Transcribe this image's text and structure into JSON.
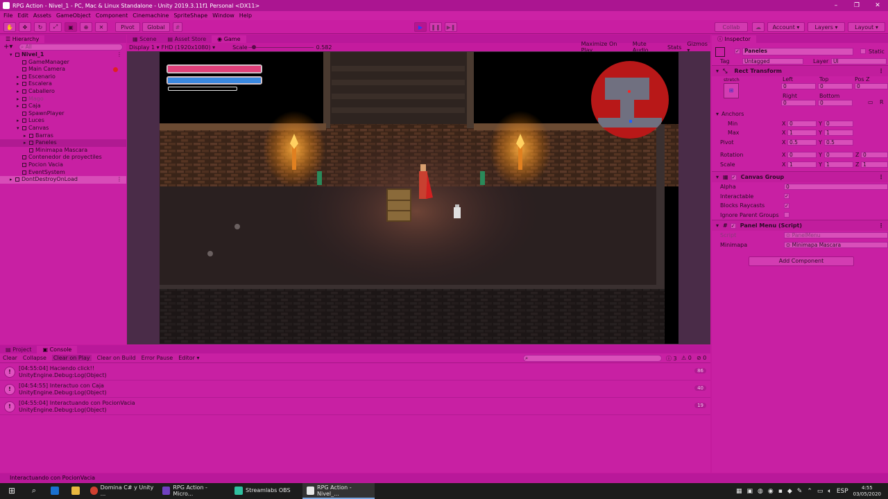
{
  "window": {
    "title": "RPG Action - Nivel_1 - PC, Mac & Linux Standalone - Unity 2019.3.11f1 Personal <DX11>"
  },
  "menu": [
    "File",
    "Edit",
    "Assets",
    "GameObject",
    "Component",
    "Cinemachine",
    "SpriteShape",
    "Window",
    "Help"
  ],
  "toolbar": {
    "pivot": "Pivot",
    "global": "Global",
    "collab": "Collab",
    "account": "Account",
    "layers": "Layers",
    "layout": "Layout"
  },
  "hierarchy": {
    "tab": "Hierarchy",
    "search_placeholder": "All",
    "items": [
      {
        "label": "Nivel_1",
        "indent": 0
      },
      {
        "label": "GameManager",
        "indent": 1
      },
      {
        "label": "Main Camera",
        "indent": 1
      },
      {
        "label": "Escenario",
        "indent": 1
      },
      {
        "label": "Escalera",
        "indent": 1
      },
      {
        "label": "Caballero",
        "indent": 1
      },
      {
        "label": "Mago",
        "indent": 1
      },
      {
        "label": "Caja",
        "indent": 1
      },
      {
        "label": "SpawnPlayer",
        "indent": 1
      },
      {
        "label": "Luces",
        "indent": 1
      },
      {
        "label": "Canvas",
        "indent": 1
      },
      {
        "label": "Barras",
        "indent": 2
      },
      {
        "label": "Paneles",
        "indent": 2
      },
      {
        "label": "Minimapa Mascara",
        "indent": 2
      },
      {
        "label": "Contenedor de proyectiles",
        "indent": 1
      },
      {
        "label": "Pocion Vacia",
        "indent": 1
      },
      {
        "label": "EventSystem",
        "indent": 1
      },
      {
        "label": "DontDestroyOnLoad",
        "indent": 0
      }
    ]
  },
  "scene_tabs": [
    "Scene",
    "Asset Store",
    "Game"
  ],
  "game_bar": {
    "display": "Display 1",
    "resolution": "FHD (1920x1080)",
    "scale_label": "Scale",
    "scale_value": "0.582",
    "scale_level": 0.05,
    "maximize": "Maximize On Play",
    "mute": "Mute Audio",
    "stats": "Stats",
    "gizmos": "Gizmos"
  },
  "hud": {
    "health_level": 1.0,
    "mana_level": 1.0,
    "xp_level": 0.0
  },
  "inspector": {
    "tab": "Inspector",
    "object_name": "Paneles",
    "static_label": "Static",
    "tag_label": "Tag",
    "tag_value": "Untagged",
    "layer_label": "Layer",
    "layer_value": "UI",
    "rect_transform": {
      "title": "Rect Transform",
      "stretch": "stretch",
      "left_label": "Left",
      "top_label": "Top",
      "posz_label": "Pos Z",
      "left": "0",
      "top": "0",
      "posz": "0",
      "right_label": "Right",
      "bottom_label": "Bottom",
      "right": "0",
      "bottom": "0",
      "anchors_label": "Anchors",
      "min_label": "Min",
      "max_label": "Max",
      "min_x": "0",
      "min_y": "0",
      "max_x": "1",
      "max_y": "1",
      "pivot_label": "Pivot",
      "pivot_x": "0.5",
      "pivot_y": "0.5",
      "rotation_label": "Rotation",
      "rot_x": "0",
      "rot_y": "0",
      "rot_z": "0",
      "scale_label": "Scale",
      "scale_x": "1",
      "scale_y": "1",
      "scale_z": "1"
    },
    "canvas_group": {
      "title": "Canvas Group",
      "alpha_label": "Alpha",
      "alpha": "0",
      "interactable_label": "Interactable",
      "blocks_label": "Blocks Raycasts",
      "ignore_label": "Ignore Parent Groups"
    },
    "panel_menu": {
      "title": "Panel Menu (Script)",
      "script_label": "Script",
      "script_value": "PanelMenu",
      "minimapa_label": "Minimapa",
      "minimapa_value": "Minimapa Mascara"
    },
    "add_component": "Add Component"
  },
  "console": {
    "tabs": [
      "Project",
      "Console"
    ],
    "buttons": [
      "Clear",
      "Collapse",
      "Clear on Play",
      "Clear on Build",
      "Error Pause",
      "Editor"
    ],
    "counts": {
      "info": "3",
      "warn": "0",
      "error": "0"
    },
    "rows": [
      {
        "line1": "[04:55:04] Haciendo click!!",
        "line2": "UnityEngine.Debug:Log(Object)",
        "count": "86"
      },
      {
        "line1": "[04:54:55] Interactuo con Caja",
        "line2": "UnityEngine.Debug:Log(Object)",
        "count": "40"
      },
      {
        "line1": "[04:55:04] Interactuando con PocionVacia",
        "line2": "UnityEngine.Debug:Log(Object)",
        "count": "19"
      }
    ]
  },
  "status": "Interactuando con PocionVacia",
  "taskbar": {
    "items": [
      "Domina C# y Unity ...",
      "RPG Action - Micro...",
      "Streamlabs OBS",
      "RPG Action - Nivel_..."
    ],
    "lang": "ESP",
    "time": "4:55",
    "date": "03/05/2020"
  }
}
